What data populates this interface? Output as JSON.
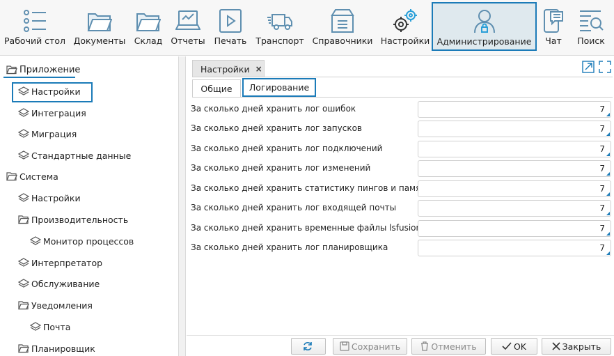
{
  "toolbar": {
    "items": [
      {
        "label": "Рабочий стол",
        "icon": "desktop-list-icon"
      },
      {
        "label": "Документы",
        "icon": "folder-icon"
      },
      {
        "label": "Склад",
        "icon": "folder-icon"
      },
      {
        "label": "Отчеты",
        "icon": "laptop-chart-icon"
      },
      {
        "label": "Печать",
        "icon": "play-document-icon"
      },
      {
        "label": "Транспорт",
        "icon": "truck-icon"
      },
      {
        "label": "Справочники",
        "icon": "box-icon"
      },
      {
        "label": "Настройки",
        "icon": "gears-icon"
      },
      {
        "label": "Администрирование",
        "icon": "user-lock-icon",
        "active": true
      },
      {
        "label": "Чат",
        "icon": "chat-phone-icon"
      },
      {
        "label": "Поиск",
        "icon": "search-list-icon"
      }
    ],
    "accent_color": "#1b7bb8",
    "icon_color": "#5f8fb0"
  },
  "tree": {
    "items": [
      {
        "label": "Приложение",
        "icon": "folder-open-icon",
        "level": 0
      },
      {
        "label": "Настройки",
        "icon": "layers-icon",
        "level": 1,
        "selected": true
      },
      {
        "label": "Интеграция",
        "icon": "layers-icon",
        "level": 1
      },
      {
        "label": "Миграция",
        "icon": "layers-icon",
        "level": 1
      },
      {
        "label": "Стандартные данные",
        "icon": "layers-icon",
        "level": 1
      },
      {
        "label": "Система",
        "icon": "folder-open-icon",
        "level": 0
      },
      {
        "label": "Настройки",
        "icon": "layers-icon",
        "level": 1
      },
      {
        "label": "Производительность",
        "icon": "folder-open-icon",
        "level": 1
      },
      {
        "label": "Монитор процессов",
        "icon": "layers-icon",
        "level": 2
      },
      {
        "label": "Интерпретатор",
        "icon": "layers-icon",
        "level": 1
      },
      {
        "label": "Обслуживание",
        "icon": "layers-icon",
        "level": 1
      },
      {
        "label": "Уведомления",
        "icon": "folder-open-icon",
        "level": 1
      },
      {
        "label": "Почта",
        "icon": "layers-icon",
        "level": 2
      },
      {
        "label": "Планировщик",
        "icon": "folder-open-icon",
        "level": 1
      }
    ]
  },
  "main": {
    "doc_tab": {
      "label": "Настройки",
      "close": "×"
    },
    "sub_tabs": [
      {
        "label": "Общие"
      },
      {
        "label": "Логирование",
        "active": true
      }
    ],
    "fields": [
      {
        "label": "За сколько дней хранить лог ошибок",
        "value": "7"
      },
      {
        "label": "За сколько дней хранить лог запусков",
        "value": "7"
      },
      {
        "label": "За сколько дней хранить лог подключений",
        "value": "7"
      },
      {
        "label": "За сколько дней хранить лог изменений",
        "value": "7"
      },
      {
        "label": "За сколько дней хранить статистику пингов и памяти",
        "value": "7"
      },
      {
        "label": "За сколько дней хранить лог входящей почты",
        "value": "7"
      },
      {
        "label": "За сколько дней хранить временные файлы lsfusion",
        "value": "7"
      },
      {
        "label": "За сколько дней хранить лог планировщика",
        "value": "7"
      }
    ],
    "buttons": {
      "refresh": {
        "icon": "refresh-icon"
      },
      "save": {
        "label": "Сохранить",
        "icon": "save-icon",
        "disabled": true
      },
      "cancel": {
        "label": "Отменить",
        "icon": "trash-icon",
        "disabled": true
      },
      "ok": {
        "label": "OK",
        "icon": "check-icon"
      },
      "close": {
        "label": "Закрыть",
        "icon": "close-icon"
      }
    }
  }
}
